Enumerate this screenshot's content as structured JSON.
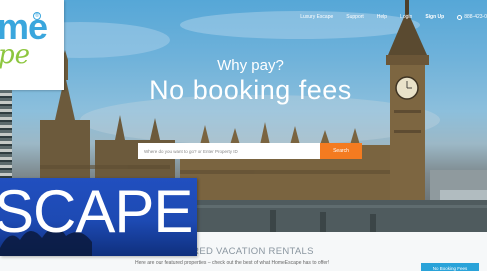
{
  "nav": {
    "items": [
      "Luxury Escape",
      "Support",
      "Help",
      "Login"
    ],
    "signup": "Sign Up",
    "phone": "888-423-0"
  },
  "hero": {
    "line1": "Why pay?",
    "line2": "No booking fees"
  },
  "search": {
    "placeholder": "Where do you want to go? or Enter Property ID",
    "button": "Search"
  },
  "featured": {
    "title": "URED VACATION RENTALS",
    "subtitle": "Here are our featured properties – check out the best of what HomeEscape has to offer!"
  },
  "badge": "No Booking Fees",
  "logo": {
    "top_text": "me",
    "registered": "®",
    "bottom_text": "pe"
  },
  "banner": {
    "text": "SCAPE"
  },
  "colors": {
    "accent": "#f47b20",
    "brand_blue": "#3aa6dd",
    "brand_green": "#8dc63f",
    "badge": "#2aa3d9"
  }
}
